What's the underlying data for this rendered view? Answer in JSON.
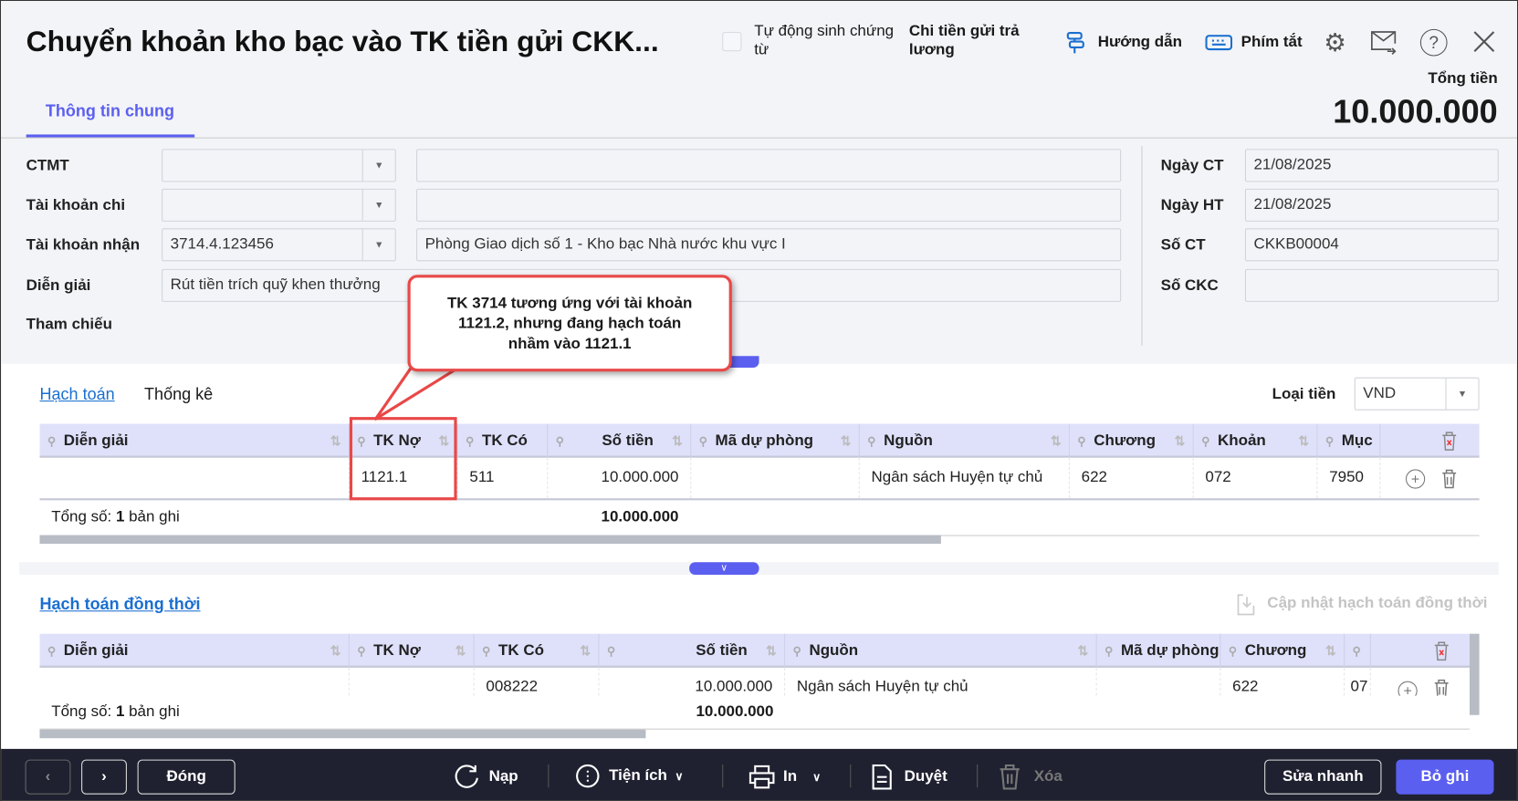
{
  "header": {
    "title": "Chuyển khoản kho bạc vào TK tiền gửi CKK...",
    "auto_gen_label": "Tự động sinh chứng từ",
    "auto_gen_checked": false,
    "auto_gen_type": "Chi tiền gửi trả lương",
    "guide": "Hướng dẫn",
    "shortcuts": "Phím tắt",
    "total_label": "Tổng tiền",
    "total_value": "10.000.000"
  },
  "tabs": {
    "general": "Thông tin chung"
  },
  "form": {
    "ctmt": {
      "label": "CTMT",
      "value": "",
      "desc": ""
    },
    "chi": {
      "label": "Tài khoản chi",
      "value": "",
      "desc": ""
    },
    "nhan": {
      "label": "Tài khoản nhận",
      "value": "3714.4.123456",
      "desc": "Phòng Giao dịch số 1 - Kho bạc Nhà nước khu vực I"
    },
    "dien_giai": {
      "label": "Diễn giải",
      "value": "Rút tiền trích quỹ khen thưởng"
    },
    "tham_chieu": {
      "label": "Tham chiếu"
    },
    "ngay_ct": {
      "label": "Ngày CT",
      "value": "21/08/2025"
    },
    "ngay_ht": {
      "label": "Ngày HT",
      "value": "21/08/2025"
    },
    "so_ct": {
      "label": "Số CT",
      "value": "CKKB00004"
    },
    "so_ckc": {
      "label": "Số CKC",
      "value": ""
    }
  },
  "callout": {
    "text": "TK 3714 tương ứng với tài khoản 1121.2, nhưng đang hạch toán nhầm vào 1121.1",
    "color": "#e94848"
  },
  "section1": {
    "tab_active": "Hạch toán",
    "tab_other": "Thống kê",
    "currency_label": "Loại tiền",
    "currency": "VND",
    "columns": [
      "Diễn giải",
      "TK Nợ",
      "TK Có",
      "Số tiền",
      "Mã dự phòng",
      "Nguồn",
      "Chương",
      "Khoản",
      "Mục"
    ],
    "row": {
      "dien_giai": "",
      "tk_no": "1121.1",
      "tk_co": "511",
      "so_tien": "10.000.000",
      "ma_du_phong": "",
      "nguon": "Ngân sách Huyện tự chủ",
      "chuong": "622",
      "khoan": "072",
      "muc": "7950"
    },
    "total_prefix": "Tổng số: ",
    "total_count": "1",
    "total_suffix": " bản ghi",
    "total_amount": "10.000.000"
  },
  "section2": {
    "title": "Hạch toán đồng thời",
    "update_label": "Cập nhật hạch toán đồng thời",
    "columns": [
      "Diễn giải",
      "TK Nợ",
      "TK Có",
      "Số tiền",
      "Nguồn",
      "Mã dự phòng",
      "Chương"
    ],
    "row": {
      "dien_giai": "",
      "tk_no": "",
      "tk_co": "008222",
      "so_tien": "10.000.000",
      "nguon": "Ngân sách Huyện tự chủ",
      "ma_du_phong": "",
      "chuong": "622",
      "extra": "07"
    },
    "total_prefix": "Tổng số: ",
    "total_count": "1",
    "total_suffix": " bản ghi",
    "total_amount": "10.000.000"
  },
  "footer": {
    "close": "Đóng",
    "reload": "Nạp",
    "utilities": "Tiện ích",
    "print": "In",
    "approve": "Duyệt",
    "delete": "Xóa",
    "quick_edit": "Sửa nhanh",
    "unpost": "Bỏ ghi"
  },
  "colors": {
    "accent": "#5b5ff0",
    "link": "#1a6fd0",
    "footer_bg": "#1f2130",
    "table_header": "#dfe1fb"
  }
}
